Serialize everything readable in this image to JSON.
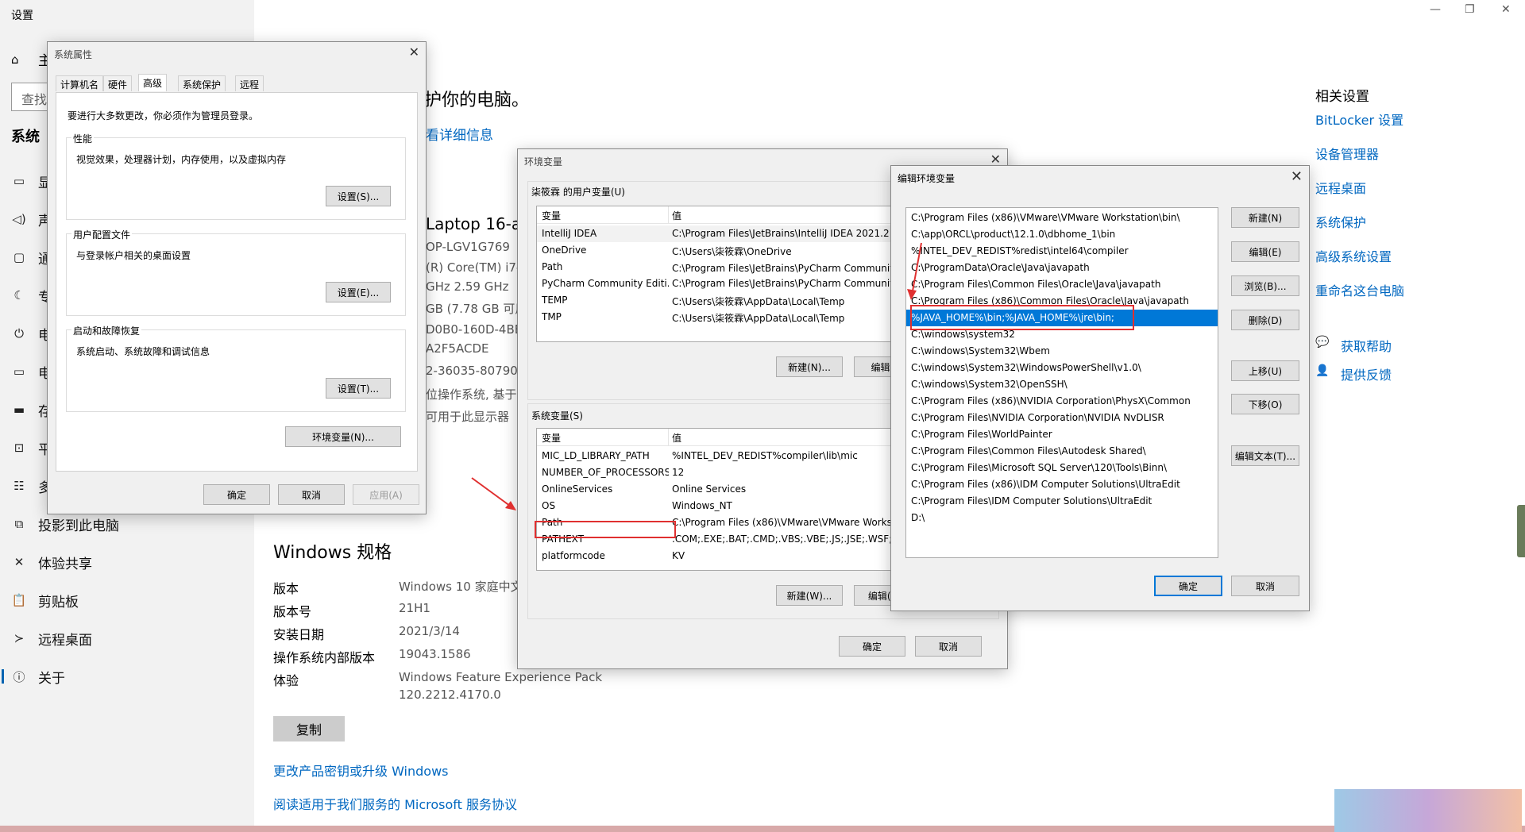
{
  "settings": {
    "title": "设置",
    "window_controls": [
      "—",
      "❐",
      "✕"
    ],
    "search_placeholder": "查找",
    "nav_home": "主",
    "section": "系统",
    "nav_items_partial": [
      {
        "icon": "display-icon",
        "label": "显"
      },
      {
        "icon": "sound-icon",
        "label": "声"
      },
      {
        "icon": "notifications-icon",
        "label": "通"
      },
      {
        "icon": "focus-assist-icon",
        "label": "专"
      },
      {
        "icon": "power-icon",
        "label": "电"
      },
      {
        "icon": "battery-icon",
        "label": "电"
      },
      {
        "icon": "storage-icon",
        "label": "存"
      },
      {
        "icon": "tablet-icon",
        "label": "平"
      },
      {
        "icon": "multitasking-icon",
        "label": "多"
      }
    ],
    "nav_items": [
      {
        "icon": "projecting-icon",
        "label": "投影到此电脑"
      },
      {
        "icon": "shared-experiences-icon",
        "label": "体验共享"
      },
      {
        "icon": "clipboard-icon",
        "label": "剪贴板"
      },
      {
        "icon": "remote-desktop-icon",
        "label": "远程桌面"
      },
      {
        "icon": "about-icon",
        "label": "关于"
      }
    ],
    "main_heading_partial": "护你的电脑。",
    "main_link_partial": "看详细信息",
    "device_partial": [
      "Laptop 16-a",
      "OP-LGV1G769",
      "(R) Core(TM) i7-",
      "GHz   2.59 GHz",
      "GB (7.78 GB 可用",
      "D0B0-160D-4BE",
      "A2F5ACDE",
      "2-36035-80790",
      "位操作系统, 基于",
      "可用于此显示器"
    ],
    "win_spec_title": "Windows 规格",
    "win_spec": [
      {
        "label": "版本",
        "value": "Windows 10 家庭中文"
      },
      {
        "label": "版本号",
        "value": "21H1"
      },
      {
        "label": "安装日期",
        "value": "2021/3/14"
      },
      {
        "label": "操作系统内部版本",
        "value": "19043.1586"
      },
      {
        "label": "体验",
        "value": "Windows Feature Experience Pack"
      }
    ],
    "experience_line2": "120.2212.4170.0",
    "copy_button": "复制",
    "link_product_key": "更改产品密钥或升级 Windows",
    "link_service_agreement": "阅读适用于我们服务的 Microsoft 服务协议",
    "related_title": "相关设置",
    "related_links": [
      "BitLocker 设置",
      "设备管理器",
      "远程桌面",
      "系统保护",
      "高级系统设置",
      "重命名这台电脑"
    ],
    "help_links": [
      {
        "icon": "help-icon",
        "label": "获取帮助"
      },
      {
        "icon": "feedback-icon",
        "label": "提供反馈"
      }
    ]
  },
  "sys_props": {
    "title": "系统属性",
    "tabs": [
      "计算机名",
      "硬件",
      "高级",
      "系统保护",
      "远程"
    ],
    "active_tab": 2,
    "admin_note": "要进行大多数更改，你必须作为管理员登录。",
    "groups": [
      {
        "label": "性能",
        "desc": "视觉效果，处理器计划，内存使用，以及虚拟内存",
        "button": "设置(S)..."
      },
      {
        "label": "用户配置文件",
        "desc": "与登录帐户相关的桌面设置",
        "button": "设置(E)..."
      },
      {
        "label": "启动和故障恢复",
        "desc": "系统启动、系统故障和调试信息",
        "button": "设置(T)..."
      }
    ],
    "env_button": "环境变量(N)...",
    "ok": "确定",
    "cancel": "取消",
    "apply": "应用(A)"
  },
  "env_vars": {
    "title": "环境变量",
    "user_section": "柒筱霖 的用户变量(U)",
    "col_var": "变量",
    "col_val": "值",
    "user_rows": [
      {
        "name": "IntelliJ IDEA",
        "value": "C:\\Program Files\\JetBrains\\IntelliJ IDEA 2021.2"
      },
      {
        "name": "OneDrive",
        "value": "C:\\Users\\柒筱霖\\OneDrive"
      },
      {
        "name": "Path",
        "value": "C:\\Program Files\\JetBrains\\PyCharm Community Edition\\bin;C:\\Users\\柒筱霖\\AppData\\Local\\Programs\\Python"
      },
      {
        "name": "PyCharm Community Editi...",
        "value": "C:\\Program Files\\JetBrains\\PyCharm Community Edition"
      },
      {
        "name": "TEMP",
        "value": "C:\\Users\\柒筱霖\\AppData\\Local\\Temp"
      },
      {
        "name": "TMP",
        "value": "C:\\Users\\柒筱霖\\AppData\\Local\\Temp"
      }
    ],
    "user_new": "新建(N)...",
    "user_edit": "编辑(E)",
    "sys_section": "系统变量(S)",
    "sys_rows": [
      {
        "name": "MIC_LD_LIBRARY_PATH",
        "value": "%INTEL_DEV_REDIST%compiler\\lib\\mic"
      },
      {
        "name": "NUMBER_OF_PROCESSORS",
        "value": "12"
      },
      {
        "name": "OnlineServices",
        "value": "Online Services"
      },
      {
        "name": "OS",
        "value": "Windows_NT"
      },
      {
        "name": "Path",
        "value": "C:\\Program Files (x86)\\VMware\\VMware Workstation\\bin\\"
      },
      {
        "name": "PATHEXT",
        "value": ".COM;.EXE;.BAT;.CMD;.VBS;.VBE;.JS;.JSE;.WSF;.WSH"
      },
      {
        "name": "platformcode",
        "value": "KV"
      }
    ],
    "sys_new": "新建(W)...",
    "sys_edit": "编辑(I)...",
    "ok": "确定",
    "cancel": "取消"
  },
  "edit_env": {
    "title": "编辑环境变量",
    "items": [
      "C:\\Program Files (x86)\\VMware\\VMware Workstation\\bin\\",
      "C:\\app\\ORCL\\product\\12.1.0\\dbhome_1\\bin",
      "%INTEL_DEV_REDIST%redist\\intel64\\compiler",
      "C:\\ProgramData\\Oracle\\Java\\javapath",
      "C:\\Program Files\\Common Files\\Oracle\\Java\\javapath",
      "C:\\Program Files (x86)\\Common Files\\Oracle\\Java\\javapath",
      "%JAVA_HOME%\\bin;%JAVA_HOME%\\jre\\bin;",
      "C:\\windows\\system32",
      "C:\\windows\\System32\\Wbem",
      "C:\\windows\\System32\\WindowsPowerShell\\v1.0\\",
      "C:\\windows\\System32\\OpenSSH\\",
      "C:\\Program Files (x86)\\NVIDIA Corporation\\PhysX\\Common",
      "C:\\Program Files\\NVIDIA Corporation\\NVIDIA NvDLISR",
      "C:\\Program Files\\WorldPainter",
      "C:\\Program Files\\Common Files\\Autodesk Shared\\",
      "C:\\Program Files\\Microsoft SQL Server\\120\\Tools\\Binn\\",
      "C:\\Program Files (x86)\\IDM Computer Solutions\\UltraEdit",
      "C:\\Program Files\\IDM Computer Solutions\\UltraEdit",
      "D:\\"
    ],
    "selected_index": 6,
    "buttons": [
      "新建(N)",
      "编辑(E)",
      "浏览(B)...",
      "删除(D)",
      "上移(U)",
      "下移(O)",
      "编辑文本(T)..."
    ],
    "ok": "确定",
    "cancel": "取消"
  },
  "colors": {
    "accent": "#0078d7",
    "link": "#0067c0",
    "highlight": "#e03030"
  }
}
